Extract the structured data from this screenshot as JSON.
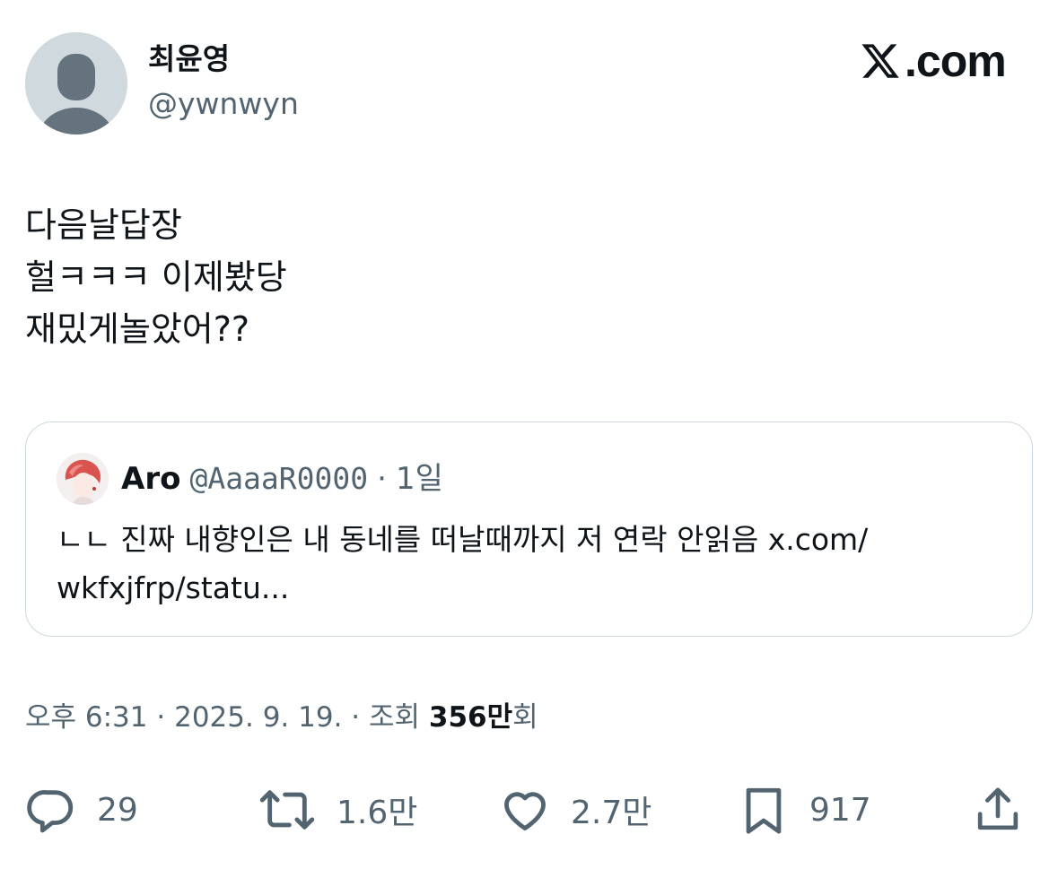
{
  "author": {
    "display_name": "최윤영",
    "handle": "@ywnwyn",
    "avatar_icon": "default-avatar-icon"
  },
  "site": {
    "logo_text": ".com",
    "logo_icon": "x-logo-icon"
  },
  "tweet": {
    "lines": [
      "다음날답장",
      "헐ㅋㅋㅋ 이제봤당",
      "재밌게놀았어??"
    ]
  },
  "quote": {
    "name": "Aro",
    "handle": "@AaaaR0000",
    "separator": "·",
    "time": "1일",
    "text_lines": [
      "ㄴㄴ 진짜 내향인은 내 동네를 떠날때까지 저 연락 안읽음 x.com/",
      "wkfxjfrp/statu..."
    ]
  },
  "meta": {
    "time": "오후 6:31",
    "date": "2025. 9. 19.",
    "separator": "·",
    "views_label": "조회",
    "views_count": "356만",
    "views_suffix": "회"
  },
  "actions": {
    "replies": "29",
    "retweets": "1.6만",
    "likes": "2.7만",
    "bookmarks": "917",
    "icons": [
      "reply-icon",
      "retweet-icon",
      "like-icon",
      "bookmark-icon",
      "share-icon"
    ]
  },
  "colors": {
    "text": "#0f1419",
    "secondary": "#536471",
    "border": "#cfd9de",
    "avatar_bg": "#cfd9de",
    "avatar_fg": "#64737d"
  }
}
